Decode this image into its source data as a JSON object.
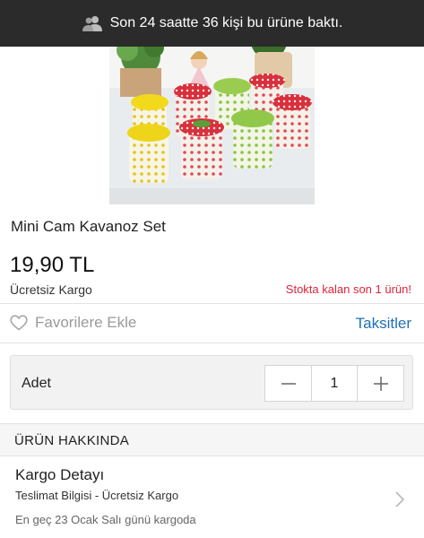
{
  "notice": {
    "icon": "people-icon",
    "text": "Son 24 saatte 36 kişi bu ürüne baktı."
  },
  "product": {
    "image_alt": "product-photo",
    "title": "Mini Cam Kavanoz Set",
    "price": "19,90 TL",
    "shipping": "Ücretsiz Kargo",
    "stock_note": "Stokta kalan son 1 ürün!"
  },
  "actions": {
    "favorite_label": "Favorilere Ekle",
    "installments_label": "Taksitler"
  },
  "quantity": {
    "label": "Adet",
    "value": "1",
    "minus_icon": "minus-icon",
    "plus_icon": "plus-icon"
  },
  "about": {
    "header": "ÜRÜN HAKKINDA",
    "cargo_title": "Kargo Detayı",
    "cargo_subtitle": "Teslimat Bilgisi - Ücretsiz Kargo",
    "cargo_date": "En geç 23 Ocak Salı günü kargoda"
  },
  "colors": {
    "notice_bg": "#2b2b2b",
    "stock_red": "#e0223a",
    "link_blue": "#1e6fb8",
    "muted_grey": "#9a9a9a"
  }
}
